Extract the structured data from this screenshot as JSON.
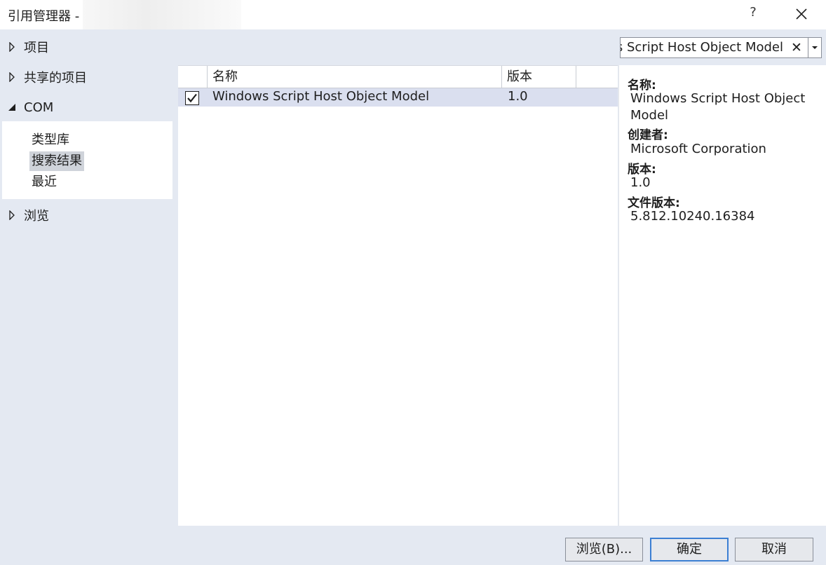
{
  "window": {
    "title": "引用管理器 -",
    "help_label": "?"
  },
  "tree": {
    "items": [
      {
        "label": "项目",
        "expanded": false
      },
      {
        "label": "共享的项目",
        "expanded": false
      },
      {
        "label": "COM",
        "expanded": true
      },
      {
        "label": "浏览",
        "expanded": false
      }
    ],
    "com_children": [
      {
        "label": "类型库",
        "selected": false
      },
      {
        "label": "搜索结果",
        "selected": true
      },
      {
        "label": "最近",
        "selected": false
      }
    ]
  },
  "search": {
    "value": "Windows Script Host Object Model",
    "clear_label": "✕"
  },
  "list": {
    "columns": [
      "名称",
      "版本"
    ],
    "rows": [
      {
        "checked": true,
        "name": "Windows Script Host Object Model",
        "version": "1.0"
      }
    ]
  },
  "details": {
    "name_label": "名称:",
    "name_value": "Windows Script Host Object Model",
    "creator_label": "创建者:",
    "creator_value": "Microsoft Corporation",
    "version_label": "版本:",
    "version_value": "1.0",
    "file_version_label": "文件版本:",
    "file_version_value": "5.812.10240.16384"
  },
  "buttons": {
    "browse": "浏览(B)...",
    "ok": "确定",
    "cancel": "取消"
  },
  "colors": {
    "accent": "#3c7fd3",
    "selection": "#dadfef",
    "background": "#e4e9f2"
  }
}
